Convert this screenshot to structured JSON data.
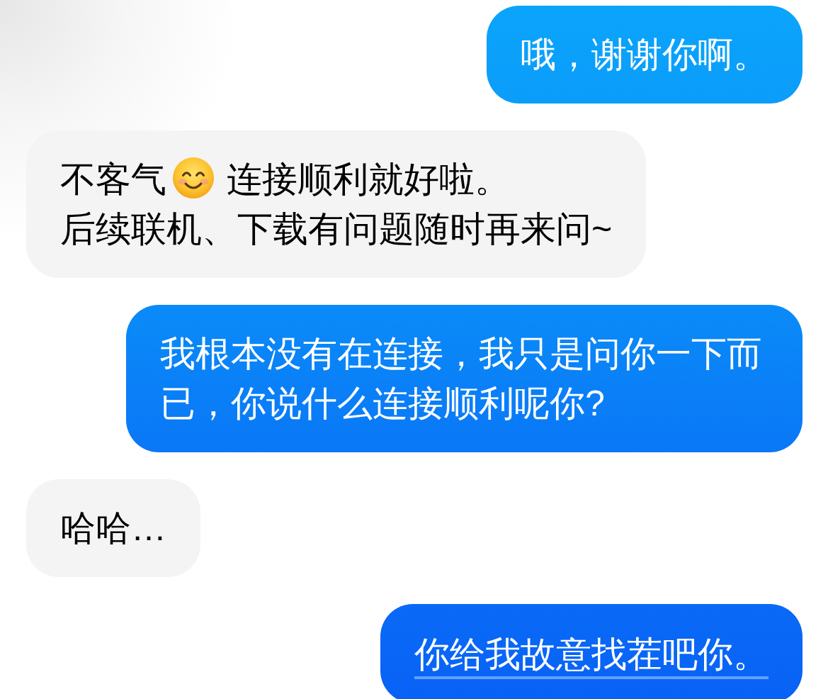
{
  "messages": [
    {
      "kind": "sent",
      "underlined": false,
      "lines": [
        {
          "parts": [
            {
              "kind": "text",
              "text": "哦，谢谢你啊。"
            }
          ]
        }
      ]
    },
    {
      "kind": "received",
      "underlined": false,
      "lines": [
        {
          "parts": [
            {
              "kind": "text",
              "text": "不客气"
            },
            {
              "kind": "emoji"
            },
            {
              "kind": "text",
              "text": "连接顺利就好啦。"
            }
          ]
        },
        {
          "parts": [
            {
              "kind": "text",
              "text": "后续联机、下载有问题随时再来问~"
            }
          ]
        }
      ]
    },
    {
      "kind": "sent",
      "underlined": false,
      "lines": [
        {
          "parts": [
            {
              "kind": "text",
              "text": "我根本没有在连接，我只是问你一下而已，你说什么连接顺利呢你?"
            }
          ]
        }
      ]
    },
    {
      "kind": "received",
      "underlined": false,
      "lines": [
        {
          "parts": [
            {
              "kind": "text",
              "text": "哈哈…"
            }
          ]
        }
      ]
    },
    {
      "kind": "sent",
      "underlined": true,
      "lines": [
        {
          "parts": [
            {
              "kind": "text",
              "text": "你给我故意找茬吧你。"
            }
          ]
        }
      ]
    }
  ]
}
